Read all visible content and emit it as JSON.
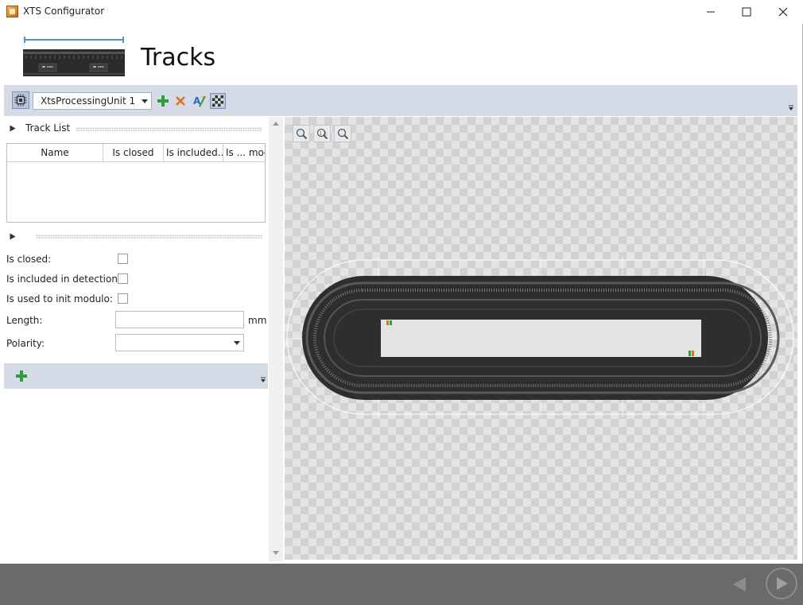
{
  "window": {
    "title": "XTS Configurator"
  },
  "header": {
    "title": "Tracks"
  },
  "toolbar": {
    "processing_unit": "XtsProcessingUnit 1"
  },
  "track_list": {
    "section_label": "Track List",
    "columns": [
      "Name",
      "Is closed",
      "Is included..",
      "Is ... mod"
    ],
    "rows": []
  },
  "properties": {
    "is_closed_label": "Is closed:",
    "is_included_label": "Is included in detection:",
    "is_used_label": "Is used to init modulo:",
    "length_label": "Length:",
    "length_value": "",
    "length_unit": "mm",
    "polarity_label": "Polarity:",
    "polarity_value": ""
  },
  "colors": {
    "toolbar_bg": "#d4dbe7",
    "footer_bg": "#6a6a6a",
    "add_green": "#2e9e3a",
    "delete_orange": "#e07020",
    "header_line_blue": "#5b8fd6"
  },
  "icons": {
    "window_icon": "xts-app-icon",
    "minimize": "minimize-icon",
    "maximize": "maximize-icon",
    "close": "close-icon",
    "add": "plus-icon",
    "delete": "x-delete-icon",
    "rename": "rename-icon",
    "grid": "checkerboard-icon",
    "zoom_in": "zoom-in-icon",
    "zoom_fit": "zoom-fit-icon",
    "zoom_out": "zoom-out-icon",
    "back": "back-arrow-icon",
    "next": "next-arrow-icon"
  }
}
